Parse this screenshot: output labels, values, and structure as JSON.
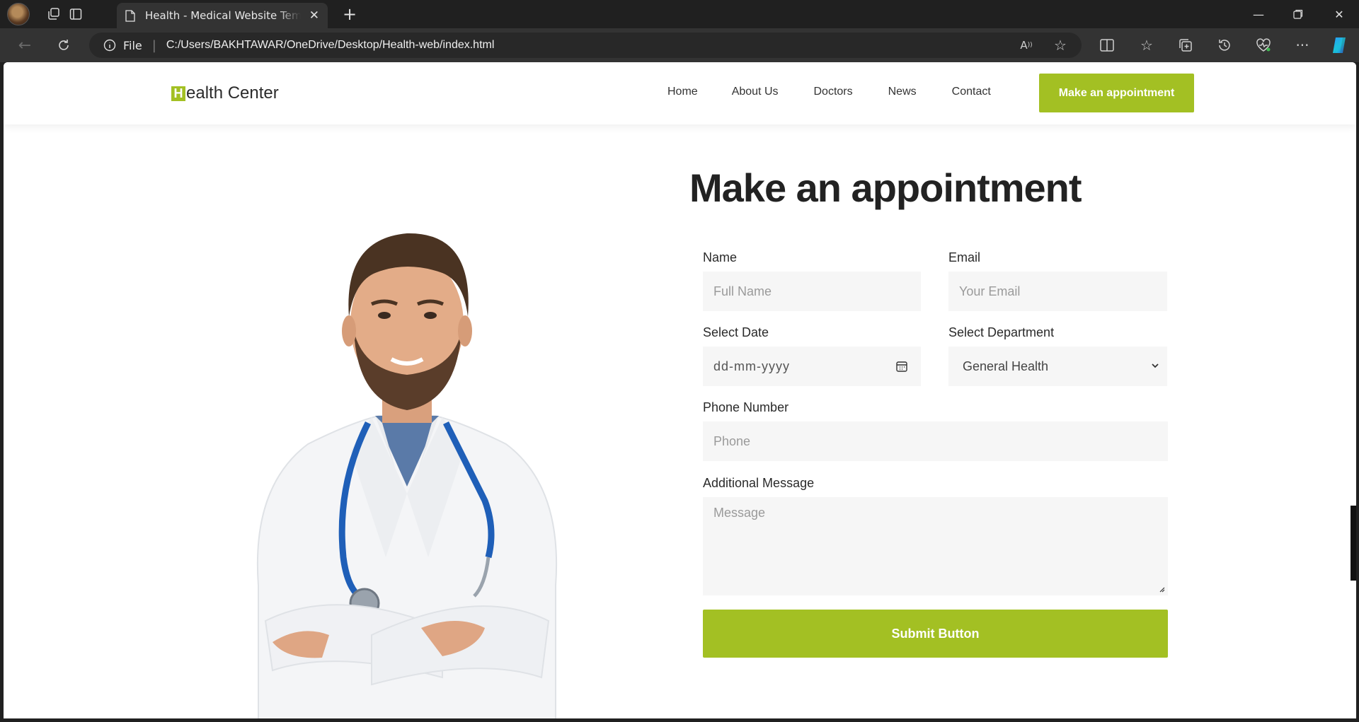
{
  "browser": {
    "tab_title": "Health - Medical Website Template",
    "omnibox_scheme": "File",
    "url": "C:/Users/BAKHTAWAR/OneDrive/Desktop/Health-web/index.html"
  },
  "site": {
    "logo_initial": "H",
    "logo_rest": "ealth Center",
    "nav": [
      "Home",
      "About Us",
      "Doctors",
      "News",
      "Contact"
    ],
    "cta_label": "Make an appointment"
  },
  "appointment": {
    "heading": "Make an appointment",
    "name_label": "Name",
    "name_placeholder": "Full Name",
    "email_label": "Email",
    "email_placeholder": "Your Email",
    "date_label": "Select Date",
    "date_placeholder": "dd-mm-yyyy",
    "department_label": "Select Department",
    "department_value": "General Health",
    "phone_label": "Phone Number",
    "phone_placeholder": "Phone",
    "message_label": "Additional Message",
    "message_placeholder": "Message",
    "submit_label": "Submit Button"
  },
  "colors": {
    "accent": "#a3c023",
    "field_bg": "#f6f6f6",
    "heading": "#222222"
  }
}
